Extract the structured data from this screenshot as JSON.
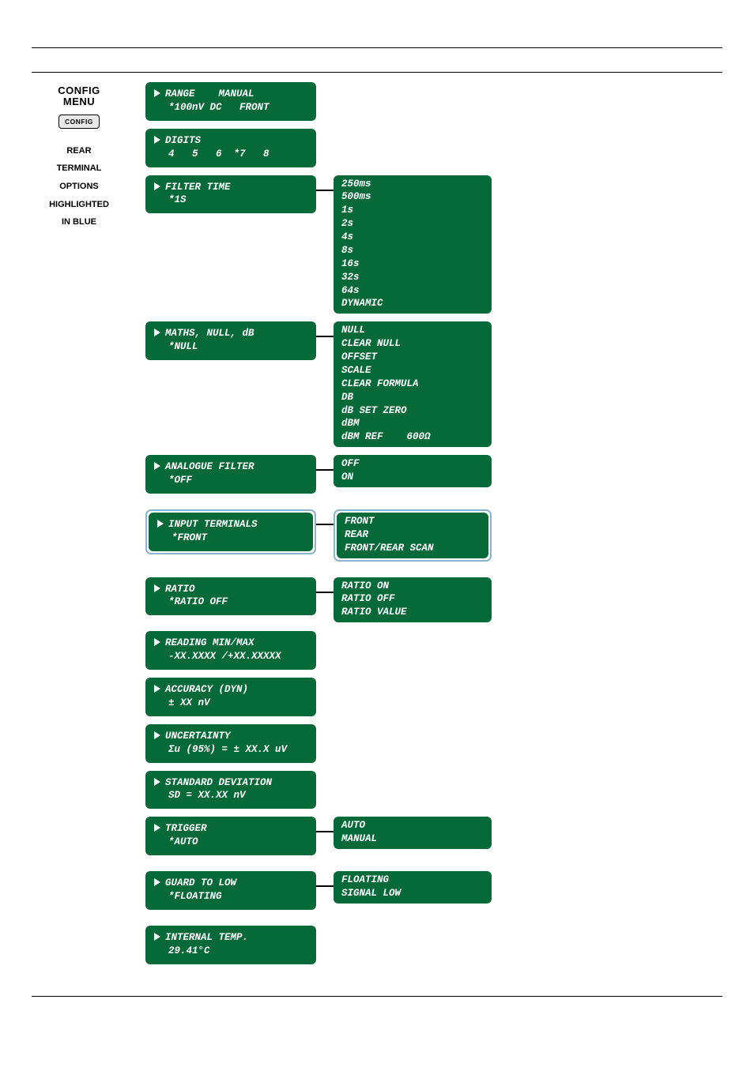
{
  "left": {
    "title1": "CONFIG",
    "title2": "MENU",
    "config_btn": "CONFIG",
    "note_l1": "REAR",
    "note_l2": "TERMINAL",
    "note_l3": "OPTIONS",
    "note2_l1": "HIGHLIGHTED",
    "note2_l2": "IN BLUE"
  },
  "menu": {
    "range": {
      "l1": "RANGE    MANUAL",
      "l2": "*100nV DC   FRONT"
    },
    "digits": {
      "l1": "DIGITS",
      "l2": "4   5   6  *7   8"
    },
    "filter": {
      "l1": "FILTER TIME",
      "l2": "*1S"
    },
    "maths": {
      "l1": "MATHS, NULL, dB",
      "l2": "*NULL"
    },
    "afilter": {
      "l1": "ANALOGUE FILTER",
      "l2": "*OFF"
    },
    "terms": {
      "l1": "INPUT TERMINALS",
      "l2": "*FRONT"
    },
    "ratio": {
      "l1": "RATIO",
      "l2": "*RATIO OFF"
    },
    "minmax": {
      "l1": "READING MIN/MAX",
      "l2": "-XX.XXXX /+XX.XXXXX"
    },
    "accuracy": {
      "l1": "ACCURACY (DYN)",
      "l2": "± XX nV"
    },
    "uncert": {
      "l1": "UNCERTAINTY",
      "l2": "Σu (95%) = ± XX.X uV"
    },
    "stddev": {
      "l1": "STANDARD DEVIATION",
      "l2": "SD = XX.XX nV"
    },
    "trigger": {
      "l1": "TRIGGER",
      "l2": "*AUTO"
    },
    "guard": {
      "l1": "GUARD TO LOW",
      "l2": "*FLOATING"
    },
    "temp": {
      "l1": "INTERNAL TEMP.",
      "l2": "29.41°C"
    }
  },
  "sub": {
    "filter": "250ms\n500ms\n1s\n2s\n4s\n8s\n16s\n32s\n64s\nDYNAMIC",
    "maths": "NULL\nCLEAR NULL\nOFFSET\nSCALE\nCLEAR FORMULA\nDB\ndB SET ZERO\ndBM\ndBM REF    600Ω",
    "afilter": "OFF\nON",
    "terms": "FRONT\nREAR\nFRONT/REAR SCAN",
    "ratio": "RATIO ON\nRATIO OFF\nRATIO VALUE",
    "trigger": "AUTO\nMANUAL",
    "guard": "FLOATING\nSIGNAL LOW"
  }
}
